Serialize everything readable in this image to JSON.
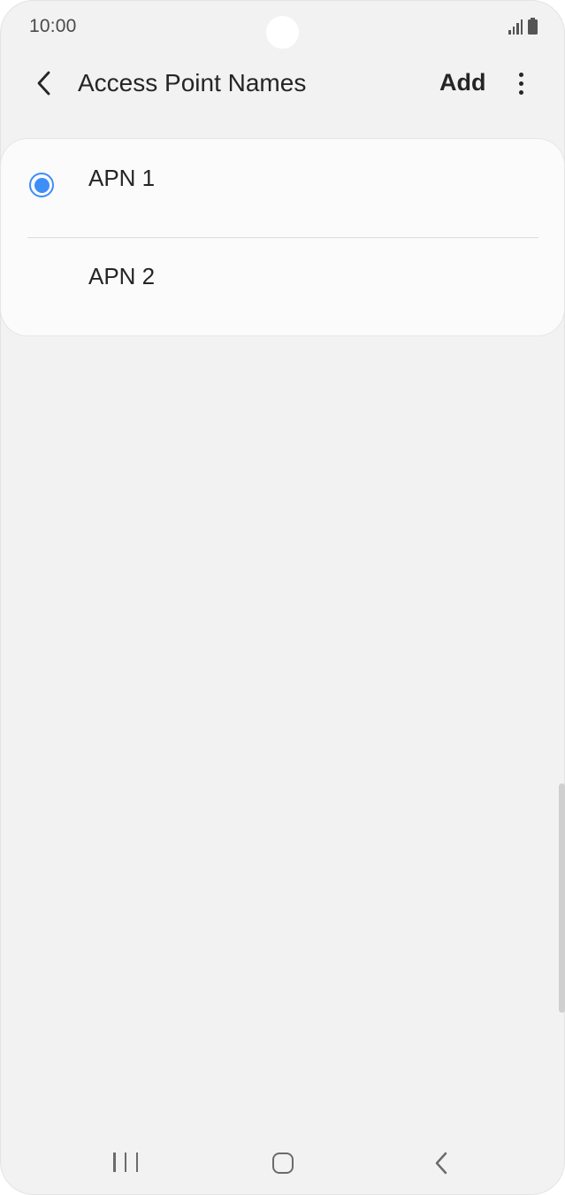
{
  "status_bar": {
    "time": "10:00",
    "icons": [
      "signal-icon",
      "battery-icon"
    ]
  },
  "header": {
    "title": "Access Point Names",
    "back_icon": "chevron-left-icon",
    "add_label": "Add",
    "more_icon": "more-vertical-icon"
  },
  "apn_list": {
    "items": [
      {
        "label": "APN 1",
        "selected": true
      },
      {
        "label": "APN 2",
        "selected": false
      }
    ]
  },
  "nav_bar": {
    "icons": [
      "recents-icon",
      "home-icon",
      "back-icon"
    ]
  },
  "colors": {
    "accent": "#3e8ef7",
    "background": "#f2f2f2",
    "card": "#fbfbfb",
    "text": "#252525"
  }
}
